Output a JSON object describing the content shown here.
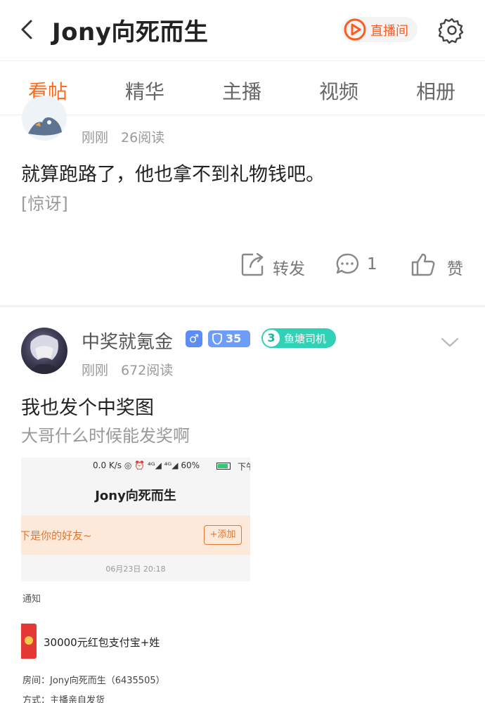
{
  "header": {
    "back_icon": "chevron-left-icon",
    "title": "Jony向死而生",
    "live_button": {
      "icon": "play-circle-icon",
      "label": "直播间"
    },
    "settings_icon": "gear-icon"
  },
  "tabs": [
    {
      "label": "看帖",
      "active": true
    },
    {
      "label": "精华",
      "active": false
    },
    {
      "label": "主播",
      "active": false
    },
    {
      "label": "视频",
      "active": false
    },
    {
      "label": "相册",
      "active": false
    }
  ],
  "posts": [
    {
      "time": "刚刚",
      "reads": "26阅读",
      "text": "就算跑路了，他也拿不到礼物钱吧。",
      "emote": "[惊讶]",
      "actions": {
        "share": "转发",
        "comments": "1",
        "like": "赞"
      }
    },
    {
      "author": "中奖就氪金",
      "gender_badge": "♂",
      "level": "35",
      "fan_level": "3",
      "fan_title": "鱼塘司机",
      "time": "刚刚",
      "reads": "672阅读",
      "text": "我也发个中奖图",
      "subtext": "大哥什么时候能发奖啊",
      "screenshot": {
        "status": "0.0 K/s ◎ ⏰ ⁴ᴳ◢ ⁴ᴳ◢ 60%",
        "status_tail": "下午",
        "title": "Jony向死而生",
        "banner_text": "下是你的好友~",
        "add_button": "+添加",
        "date": "06月23日 20:18",
        "notice": "通知",
        "prize": "30000元红包支付宝+姓",
        "room": "房间：Jony向死而生（6435505）",
        "method": "方式：主播亲自发货"
      }
    }
  ],
  "colors": {
    "accent": "#ff6a1f",
    "level_badge": "#6c9df8",
    "fan_badge": "#30d1b5"
  }
}
